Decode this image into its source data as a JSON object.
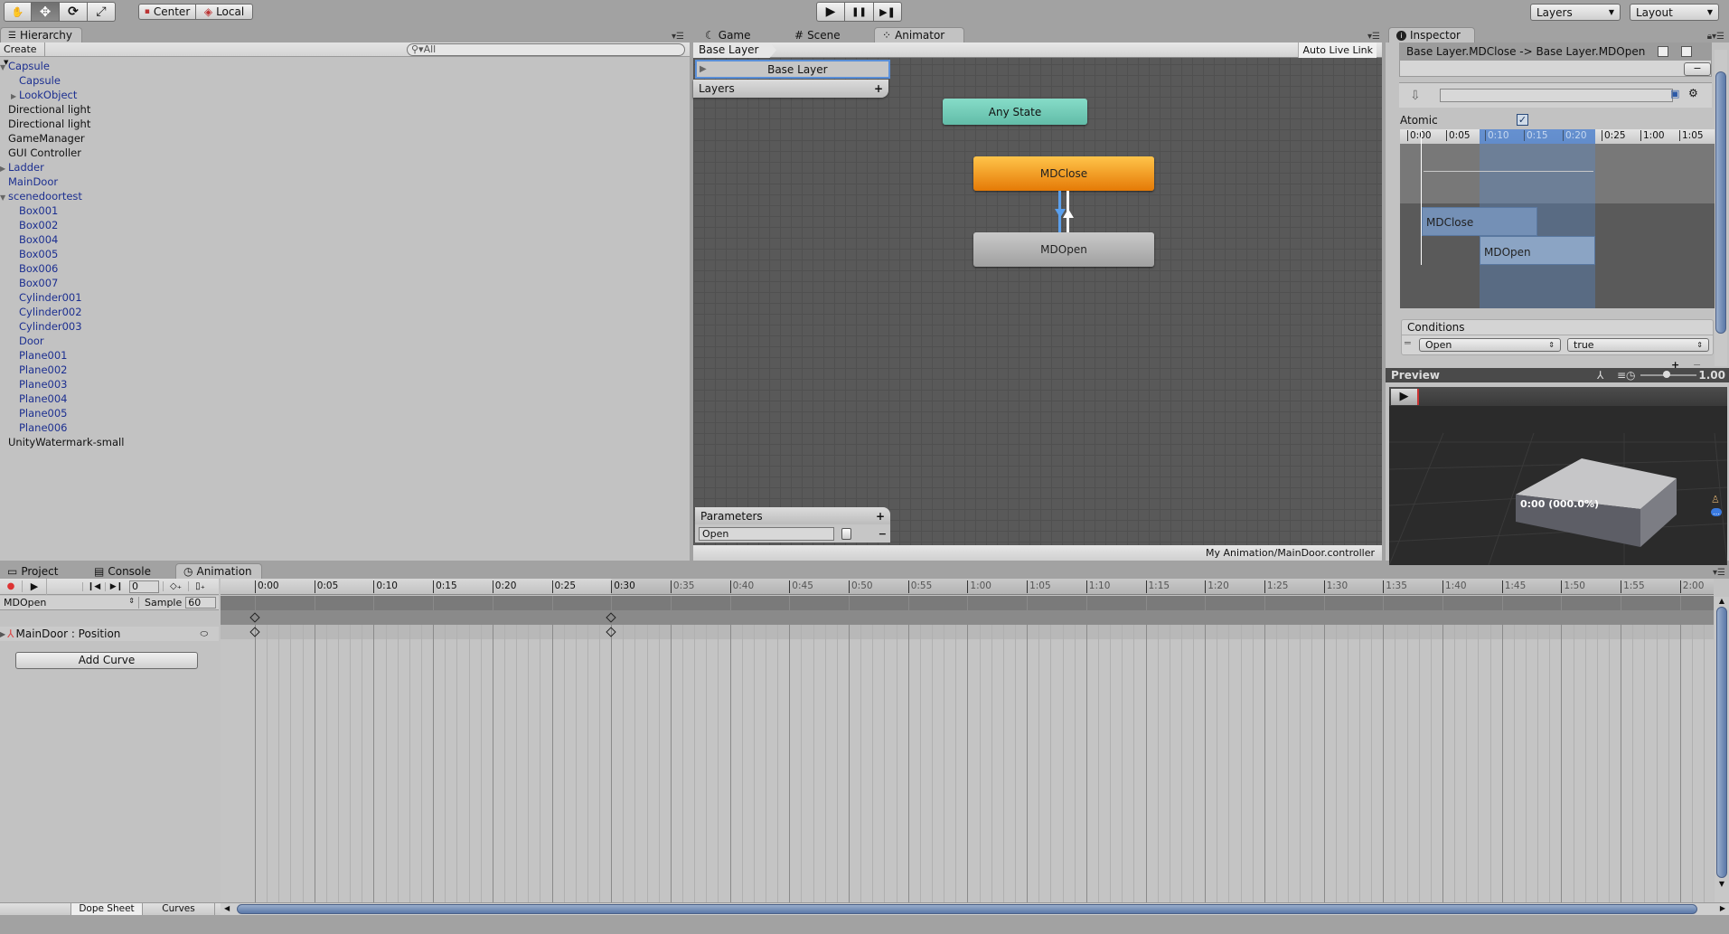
{
  "toolbar": {
    "tools": [
      {
        "name": "hand-tool",
        "glyph": "✋"
      },
      {
        "name": "move-tool",
        "glyph": "✥"
      },
      {
        "name": "rotate-tool",
        "glyph": "⟳"
      },
      {
        "name": "scale-tool",
        "glyph": "⤢"
      }
    ],
    "pivot_mode": "Center",
    "pivot_rotation": "Local",
    "play": "▶",
    "pause": "❚❚",
    "step": "▶❚",
    "layers_label": "Layers",
    "layout_label": "Layout"
  },
  "hierarchy": {
    "tab_label": "Hierarchy",
    "create_label": "Create",
    "search_placeholder": "All",
    "items": [
      {
        "label": "Capsule",
        "indent": 0,
        "arrow": "▼",
        "prefab": true
      },
      {
        "label": "Capsule",
        "indent": 1,
        "arrow": "",
        "prefab": true
      },
      {
        "label": "LookObject",
        "indent": 1,
        "arrow": "▶",
        "prefab": true
      },
      {
        "label": "Directional light",
        "indent": 0,
        "arrow": "",
        "prefab": false
      },
      {
        "label": "Directional light",
        "indent": 0,
        "arrow": "",
        "prefab": false
      },
      {
        "label": "GameManager",
        "indent": 0,
        "arrow": "",
        "prefab": false
      },
      {
        "label": "GUI Controller",
        "indent": 0,
        "arrow": "",
        "prefab": false
      },
      {
        "label": "Ladder",
        "indent": 0,
        "arrow": "▶",
        "prefab": true
      },
      {
        "label": "MainDoor",
        "indent": 0,
        "arrow": "",
        "prefab": true
      },
      {
        "label": "scenedoortest",
        "indent": 0,
        "arrow": "▼",
        "prefab": true
      },
      {
        "label": "Box001",
        "indent": 1,
        "arrow": "",
        "prefab": true
      },
      {
        "label": "Box002",
        "indent": 1,
        "arrow": "",
        "prefab": true
      },
      {
        "label": "Box004",
        "indent": 1,
        "arrow": "",
        "prefab": true
      },
      {
        "label": "Box005",
        "indent": 1,
        "arrow": "",
        "prefab": true
      },
      {
        "label": "Box006",
        "indent": 1,
        "arrow": "",
        "prefab": true
      },
      {
        "label": "Box007",
        "indent": 1,
        "arrow": "",
        "prefab": true
      },
      {
        "label": "Cylinder001",
        "indent": 1,
        "arrow": "",
        "prefab": true
      },
      {
        "label": "Cylinder002",
        "indent": 1,
        "arrow": "",
        "prefab": true
      },
      {
        "label": "Cylinder003",
        "indent": 1,
        "arrow": "",
        "prefab": true
      },
      {
        "label": "Door",
        "indent": 1,
        "arrow": "",
        "prefab": true
      },
      {
        "label": "Plane001",
        "indent": 1,
        "arrow": "",
        "prefab": true
      },
      {
        "label": "Plane002",
        "indent": 1,
        "arrow": "",
        "prefab": true
      },
      {
        "label": "Plane003",
        "indent": 1,
        "arrow": "",
        "prefab": true
      },
      {
        "label": "Plane004",
        "indent": 1,
        "arrow": "",
        "prefab": true
      },
      {
        "label": "Plane005",
        "indent": 1,
        "arrow": "",
        "prefab": true
      },
      {
        "label": "Plane006",
        "indent": 1,
        "arrow": "",
        "prefab": true
      },
      {
        "label": "UnityWatermark-small",
        "indent": 0,
        "arrow": "",
        "prefab": false
      }
    ]
  },
  "center_tabs": [
    {
      "label": "Game",
      "icon": "☾"
    },
    {
      "label": "Scene",
      "icon": "#"
    },
    {
      "label": "Animator",
      "icon": "⁘"
    }
  ],
  "animator": {
    "breadcrumb": "Base Layer",
    "auto_live_link": "Auto Live Link",
    "layer_name": "Base Layer",
    "layers_label": "Layers",
    "nodes": [
      {
        "label": "Any State",
        "kind": "any",
        "color": "#7fd6c2"
      },
      {
        "label": "MDClose",
        "kind": "default",
        "color": "#f59a1a"
      },
      {
        "label": "MDOpen",
        "kind": "normal",
        "color": "#b4b4b4"
      }
    ],
    "parameters_label": "Parameters",
    "parameters": [
      {
        "name": "Open",
        "type": "bool",
        "value": false
      }
    ],
    "controller_path": "My Animation/MainDoor.controller"
  },
  "inspector": {
    "tab_label": "Inspector",
    "transition_name": "Base Layer.MDClose -> Base Layer.MDOpen",
    "atomic_label": "Atomic",
    "atomic_checked": true,
    "ruler_ticks": [
      "0:00",
      "0:05",
      "0:10",
      "0:15",
      "0:20",
      "0:25",
      "1:00",
      "1:05"
    ],
    "clip_from": "MDClose",
    "clip_to": "MDOpen",
    "conditions_label": "Conditions",
    "condition_param": "Open",
    "condition_value": "true",
    "preview_label": "Preview",
    "preview_speed": "1.00",
    "preview_time": "0:00 (000.0%)"
  },
  "bottom_tabs": [
    {
      "label": "Project",
      "icon": "▭"
    },
    {
      "label": "Console",
      "icon": "▤"
    },
    {
      "label": "Animation",
      "icon": "◷"
    }
  ],
  "animation": {
    "frame": "0",
    "clip": "MDOpen",
    "sample_label": "Sample",
    "sample": "60",
    "property": "MainDoor : Position",
    "add_curve": "Add Curve",
    "dope_sheet": "Dope Sheet",
    "curves": "Curves",
    "ticks": [
      "0:00",
      "0:05",
      "0:10",
      "0:15",
      "0:20",
      "0:25",
      "0:30",
      "0:35",
      "0:40",
      "0:45",
      "0:50",
      "0:55",
      "1:00",
      "1:05",
      "1:10",
      "1:15",
      "1:20",
      "1:25",
      "1:30",
      "1:35",
      "1:40",
      "1:45",
      "1:50",
      "1:55",
      "2:00"
    ],
    "keyframes": [
      "0:00",
      "0:30"
    ],
    "clip_end": "0:30"
  }
}
